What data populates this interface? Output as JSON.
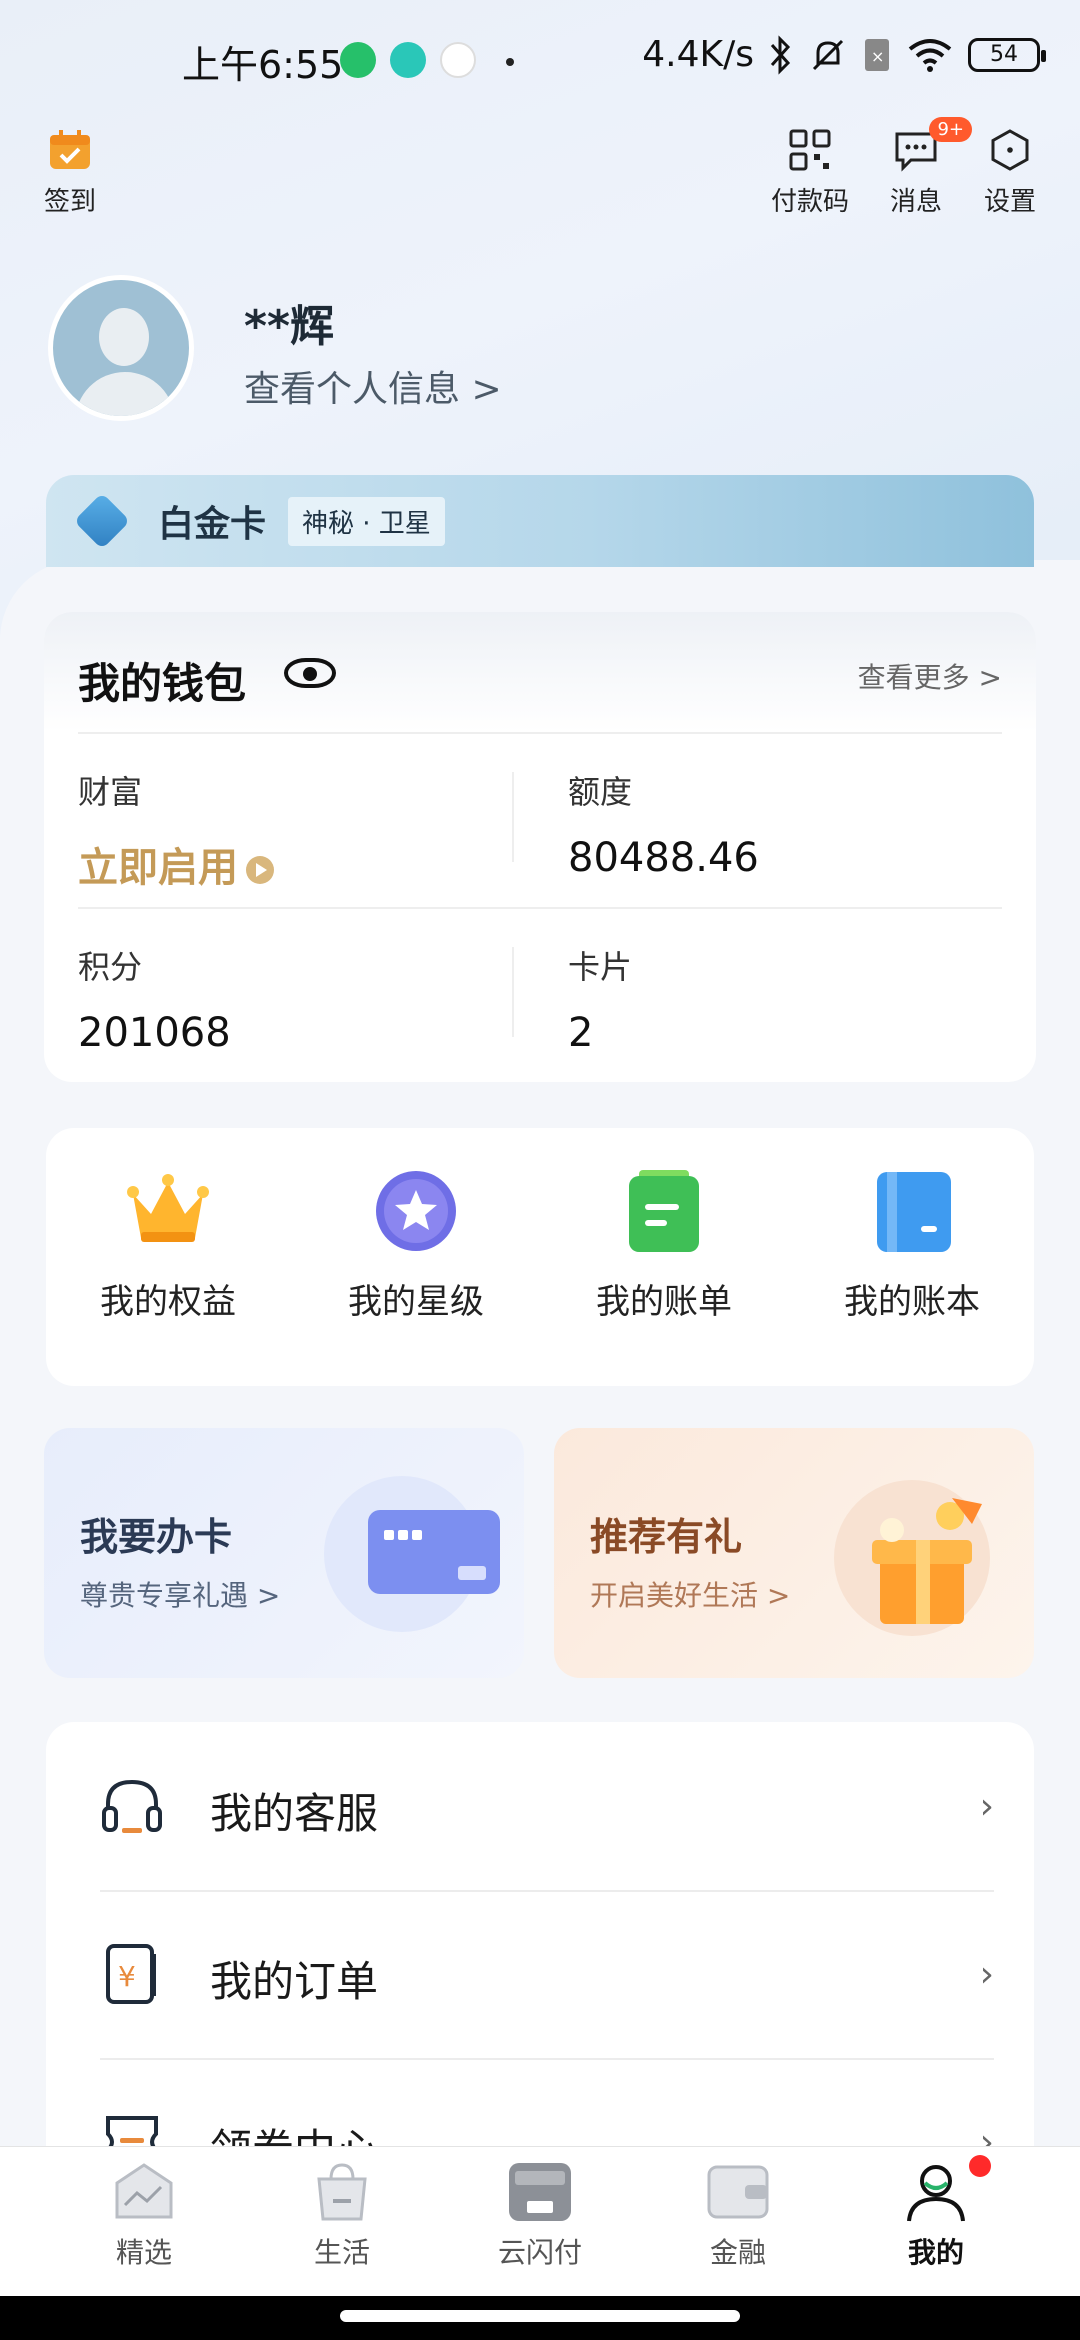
{
  "status_bar": {
    "time": "上午6:55",
    "net_speed": "4.4K/s",
    "battery": "54"
  },
  "topbar": {
    "checkin_label": "签到",
    "paycode_label": "付款码",
    "messages_label": "消息",
    "messages_badge": "9+",
    "settings_label": "设置"
  },
  "profile": {
    "name": "**辉",
    "info_link": "查看个人信息 >"
  },
  "tier": {
    "name": "白金卡",
    "tag": "神秘 · 卫星"
  },
  "wallet": {
    "title": "我的钱包",
    "more": "查看更多 >",
    "cells": [
      {
        "label": "财富",
        "value": "立即启用"
      },
      {
        "label": "额度",
        "value": "80488.46"
      },
      {
        "label": "积分",
        "value": "201068"
      },
      {
        "label": "卡片",
        "value": "2"
      }
    ]
  },
  "quick": [
    {
      "label": "我的权益",
      "icon": "crown-icon"
    },
    {
      "label": "我的星级",
      "icon": "star-badge-icon"
    },
    {
      "label": "我的账单",
      "icon": "bill-icon"
    },
    {
      "label": "我的账本",
      "icon": "ledger-icon"
    }
  ],
  "promos": [
    {
      "title": "我要办卡",
      "subtitle": "尊贵专享礼遇 >",
      "color": "#2b3a55"
    },
    {
      "title": "推荐有礼",
      "subtitle": "开启美好生活 >",
      "color": "#8a4a26"
    }
  ],
  "list": [
    {
      "label": "我的客服",
      "icon": "headset-icon"
    },
    {
      "label": "我的订单",
      "icon": "order-receipt-icon"
    },
    {
      "label": "领券中心",
      "icon": "coupon-icon"
    }
  ],
  "tabs": [
    {
      "label": "精选",
      "icon": "featured-icon"
    },
    {
      "label": "生活",
      "icon": "shopping-bag-icon"
    },
    {
      "label": "云闪付",
      "icon": "unionpay-icon"
    },
    {
      "label": "金融",
      "icon": "wallet-icon"
    },
    {
      "label": "我的",
      "icon": "profile-icon"
    }
  ],
  "colors": {
    "gold": "#c49a57",
    "promo_orange": "#ff5a2c",
    "notify_red": "#ff2a2a"
  }
}
